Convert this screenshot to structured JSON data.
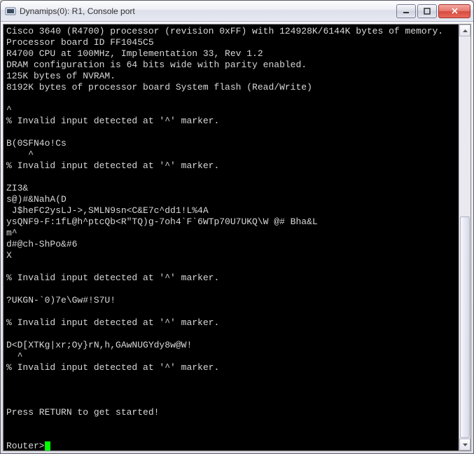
{
  "window": {
    "title": "Dynamips(0): R1, Console port"
  },
  "terminal": {
    "lines": [
      "Cisco 3640 (R4700) processor (revision 0xFF) with 124928K/6144K bytes of memory.",
      "Processor board ID FF1045C5",
      "R4700 CPU at 100MHz, Implementation 33, Rev 1.2",
      "DRAM configuration is 64 bits wide with parity enabled.",
      "125K bytes of NVRAM.",
      "8192K bytes of processor board System flash (Read/Write)",
      "",
      "^",
      "% Invalid input detected at '^' marker.",
      "",
      "B(0SFN4o!Cs",
      "    ^",
      "% Invalid input detected at '^' marker.",
      "",
      "ZI3&",
      "s@)#&NahA(D",
      " J$heFC2ysLJ->,SMLN9sn<C&E7c^dd1!L%4A",
      "ysQNF9-F:1fL@h^ptcQb<R\"TQ)g-7oh4`F`6WTp70U7UKQ\\W @# Bha&L",
      "m^",
      "d#@ch-ShPo&#6",
      "X",
      "",
      "% Invalid input detected at '^' marker.",
      "",
      "?UKGN-`0)7e\\Gw#!S7U!",
      "",
      "% Invalid input detected at '^' marker.",
      "",
      "D<D[XTKg|xr;Oy}rN,h,GAwNUGYdy8w@W!",
      "  ^",
      "% Invalid input detected at '^' marker.",
      "",
      "",
      "",
      "Press RETURN to get started!",
      "",
      ""
    ],
    "prompt": "Router>"
  }
}
